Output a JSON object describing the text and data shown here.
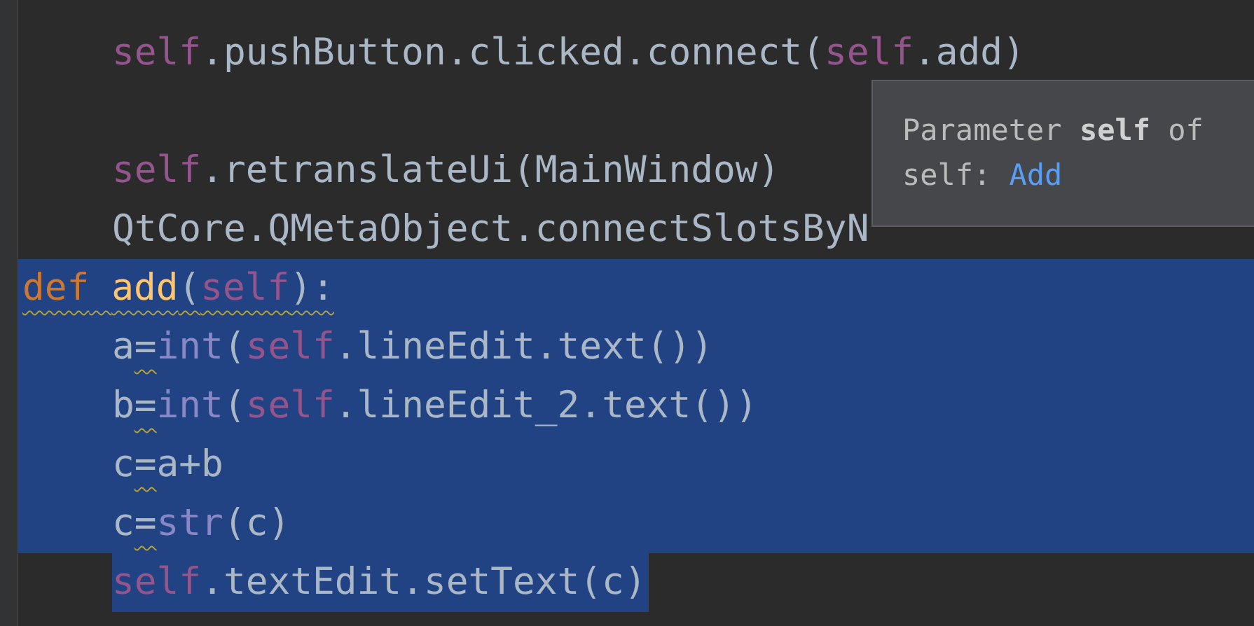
{
  "editor": {
    "blocks": [
      {
        "body": [
          {
            "selected": false,
            "tokens": [
              {
                "text": "self",
                "kind": "self"
              },
              {
                "text": ".pushButton.clicked.connect(",
                "kind": "plain"
              },
              {
                "text": "self",
                "kind": "self"
              },
              {
                "text": ".add)",
                "kind": "plain"
              }
            ]
          },
          {
            "selected": false
          },
          {
            "selected": false,
            "tokens": [
              {
                "text": "self",
                "kind": "self"
              },
              {
                "text": ".retranslateUi(MainWindow)",
                "kind": "plain"
              }
            ]
          },
          {
            "selected": false,
            "tokens": [
              {
                "text": "QtCore.QMetaObject.connectSlotsByN",
                "kind": "plain"
              }
            ]
          }
        ]
      },
      {
        "header": {
          "selected": true,
          "warning": true,
          "tokens": [
            {
              "text": "def",
              "kind": "keyword"
            },
            {
              "text": "add",
              "kind": "function"
            },
            {
              "text": "(",
              "kind": "plain"
            },
            {
              "text": "self",
              "kind": "self"
            },
            {
              "text": "):",
              "kind": "plain"
            }
          ]
        },
        "body": [
          {
            "selected": true,
            "tokens": [
              {
                "text": "a",
                "kind": "plain"
              },
              {
                "text": "=",
                "kind": "flagged"
              },
              {
                "text": "int",
                "kind": "builtin"
              },
              {
                "text": "(",
                "kind": "plain"
              },
              {
                "text": "self",
                "kind": "self"
              },
              {
                "text": ".lineEdit.text())",
                "kind": "plain"
              }
            ]
          },
          {
            "selected": true,
            "tokens": [
              {
                "text": "b",
                "kind": "plain"
              },
              {
                "text": "=",
                "kind": "flagged"
              },
              {
                "text": "int",
                "kind": "builtin"
              },
              {
                "text": "(",
                "kind": "plain"
              },
              {
                "text": "self",
                "kind": "self"
              },
              {
                "text": ".lineEdit_2.text())",
                "kind": "plain"
              }
            ]
          },
          {
            "selected": true,
            "tokens": [
              {
                "text": "c",
                "kind": "plain"
              },
              {
                "text": "=",
                "kind": "flagged"
              },
              {
                "text": "a+b",
                "kind": "plain"
              }
            ]
          },
          {
            "selected": true,
            "tokens": [
              {
                "text": "c",
                "kind": "plain"
              },
              {
                "text": "=",
                "kind": "flagged"
              },
              {
                "text": "str",
                "kind": "builtin"
              },
              {
                "text": "(c)",
                "kind": "plain"
              }
            ]
          },
          {
            "selected": true,
            "tokens": [
              {
                "text": "self",
                "kind": "self"
              },
              {
                "text": ".textEdit.setText(c)",
                "kind": "plain"
              }
            ]
          }
        ]
      }
    ]
  },
  "tooltip": {
    "heading": "Parameter **self** of",
    "type_label": "self:",
    "type_link": "Add"
  }
}
